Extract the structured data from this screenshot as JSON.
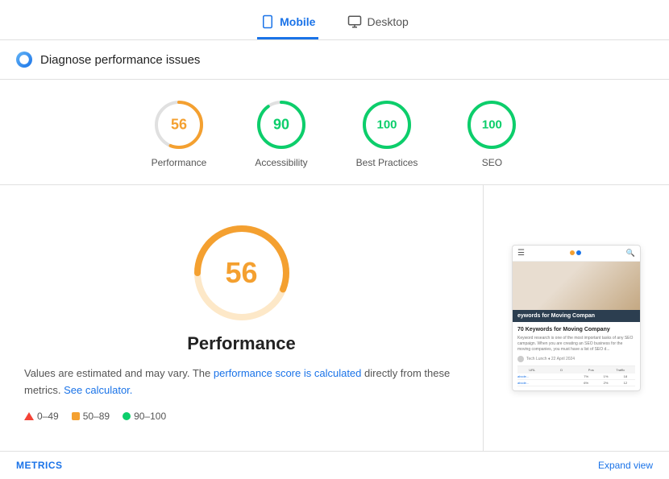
{
  "tabs": [
    {
      "id": "mobile",
      "label": "Mobile",
      "active": true
    },
    {
      "id": "desktop",
      "label": "Desktop",
      "active": false
    }
  ],
  "diagnose": {
    "title": "Diagnose performance issues"
  },
  "scores": [
    {
      "id": "performance",
      "value": 56,
      "label": "Performance",
      "color": "#f4a030",
      "pct": 56
    },
    {
      "id": "accessibility",
      "value": 90,
      "label": "Accessibility",
      "color": "#0cce6b",
      "pct": 90
    },
    {
      "id": "best-practices",
      "value": 100,
      "label": "Best Practices",
      "color": "#0cce6b",
      "pct": 100
    },
    {
      "id": "seo",
      "value": 100,
      "label": "SEO",
      "color": "#0cce6b",
      "pct": 100
    }
  ],
  "performance": {
    "score": 56,
    "title": "Performance",
    "description": "Values are estimated and may vary. The",
    "link1": "performance score is calculated",
    "link1_suffix": "directly from these metrics.",
    "link2": "See calculator.",
    "legend": [
      {
        "type": "triangle",
        "range": "0–49"
      },
      {
        "type": "square",
        "range": "50–89"
      },
      {
        "type": "dot",
        "range": "90–100"
      }
    ]
  },
  "preview": {
    "banner_text": "eywords for Moving Compan",
    "main_title": "70 Keywords for Moving Company",
    "sub_text": "Keyword research is one of the most important tasks of any SEO campaign. When you are creating an SEO business for the moving companies, you must have a list of SEO d...",
    "author_text": "Tech Lunch  ♦ 22 April 2024"
  },
  "footer": {
    "metrics_label": "METRICS",
    "expand_label": "Expand view"
  }
}
